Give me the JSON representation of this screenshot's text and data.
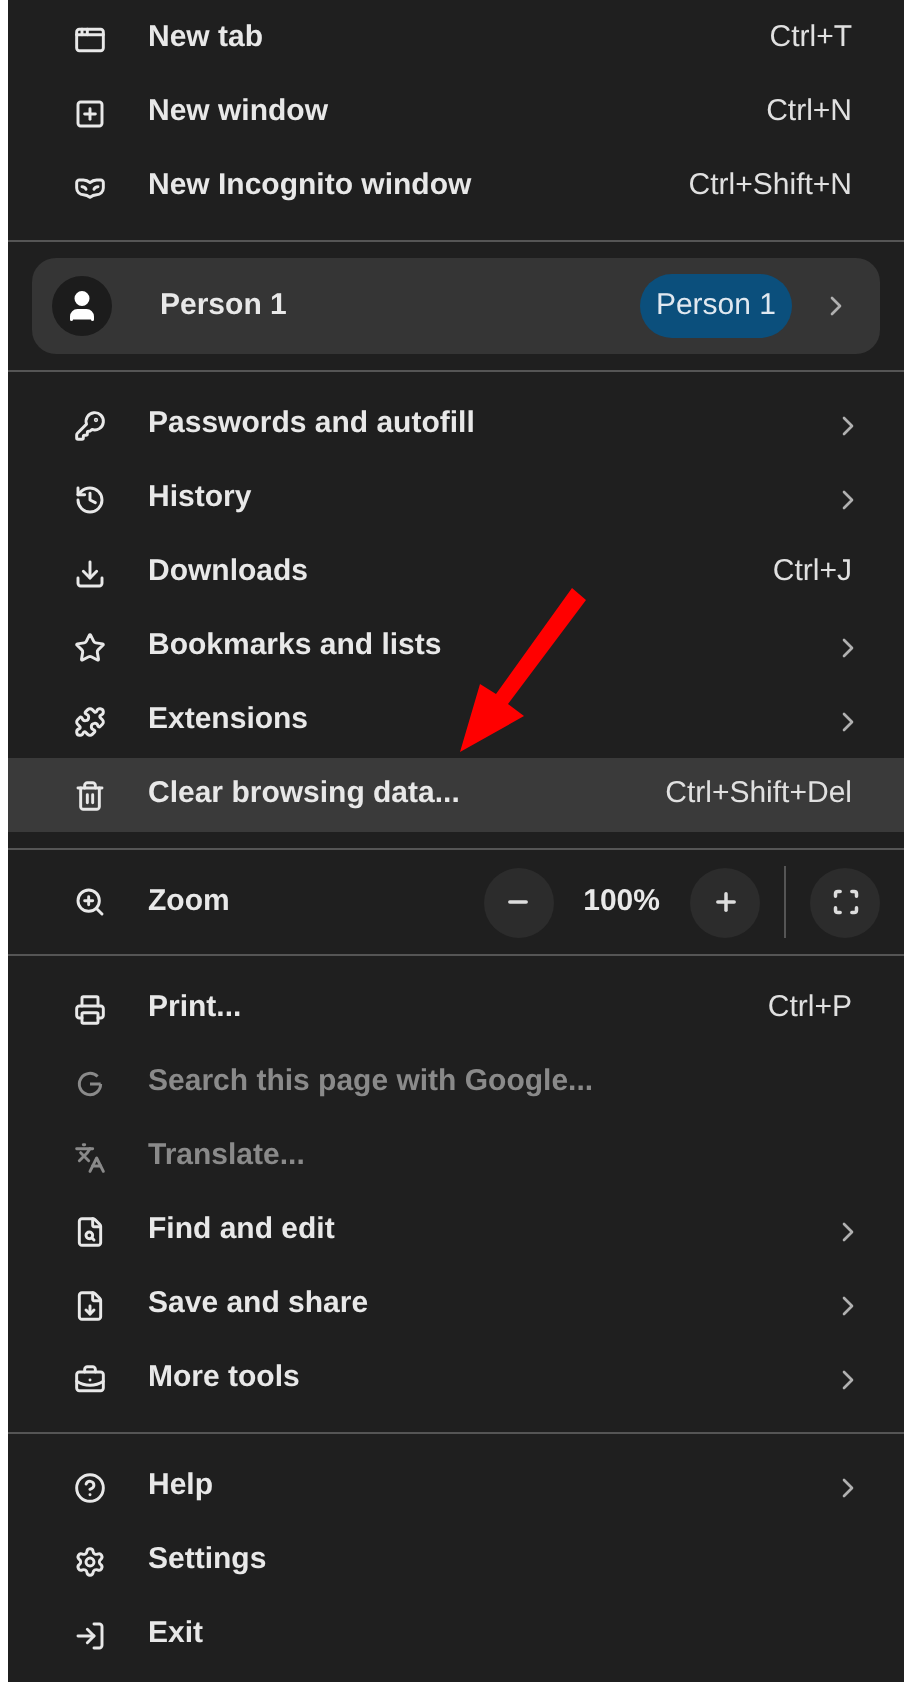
{
  "sections": [
    {
      "kind": "items",
      "items": [
        {
          "label": "New tab",
          "shortcut": "Ctrl+T",
          "submenu": false,
          "disabled": false,
          "selected": false
        },
        {
          "label": "New window",
          "shortcut": "Ctrl+N",
          "submenu": false,
          "disabled": false,
          "selected": false
        },
        {
          "label": "New Incognito window",
          "shortcut": "Ctrl+Shift+N",
          "submenu": false,
          "disabled": false,
          "selected": false
        }
      ]
    },
    {
      "kind": "profile",
      "name": "Person 1",
      "badge": "Person 1",
      "submenu": true
    },
    {
      "kind": "items",
      "items": [
        {
          "label": "Passwords and autofill",
          "submenu": true,
          "disabled": false,
          "selected": false
        },
        {
          "label": "History",
          "submenu": true,
          "disabled": false,
          "selected": false
        },
        {
          "label": "Downloads",
          "shortcut": "Ctrl+J",
          "submenu": false,
          "disabled": false,
          "selected": false
        },
        {
          "label": "Bookmarks and lists",
          "submenu": true,
          "disabled": false,
          "selected": false
        },
        {
          "label": "Extensions",
          "submenu": true,
          "disabled": false,
          "selected": false
        },
        {
          "label": "Clear browsing data...",
          "shortcut": "Ctrl+Shift+Del",
          "submenu": false,
          "disabled": false,
          "selected": true
        }
      ]
    },
    {
      "kind": "zoom",
      "label": "Zoom",
      "value": "100%"
    },
    {
      "kind": "items",
      "items": [
        {
          "label": "Print...",
          "shortcut": "Ctrl+P",
          "submenu": false,
          "disabled": false,
          "selected": false
        },
        {
          "label": "Search this page with Google...",
          "submenu": false,
          "disabled": true,
          "selected": false
        },
        {
          "label": "Translate...",
          "submenu": false,
          "disabled": true,
          "selected": false
        },
        {
          "label": "Find and edit",
          "submenu": true,
          "disabled": false,
          "selected": false
        },
        {
          "label": "Save and share",
          "submenu": true,
          "disabled": false,
          "selected": false
        },
        {
          "label": "More tools",
          "submenu": true,
          "disabled": false,
          "selected": false
        }
      ]
    },
    {
      "kind": "items",
      "items": [
        {
          "label": "Help",
          "submenu": true,
          "disabled": false,
          "selected": false
        },
        {
          "label": "Settings",
          "submenu": false,
          "disabled": false,
          "selected": false
        },
        {
          "label": "Exit",
          "submenu": false,
          "disabled": false,
          "selected": false
        }
      ]
    }
  ]
}
